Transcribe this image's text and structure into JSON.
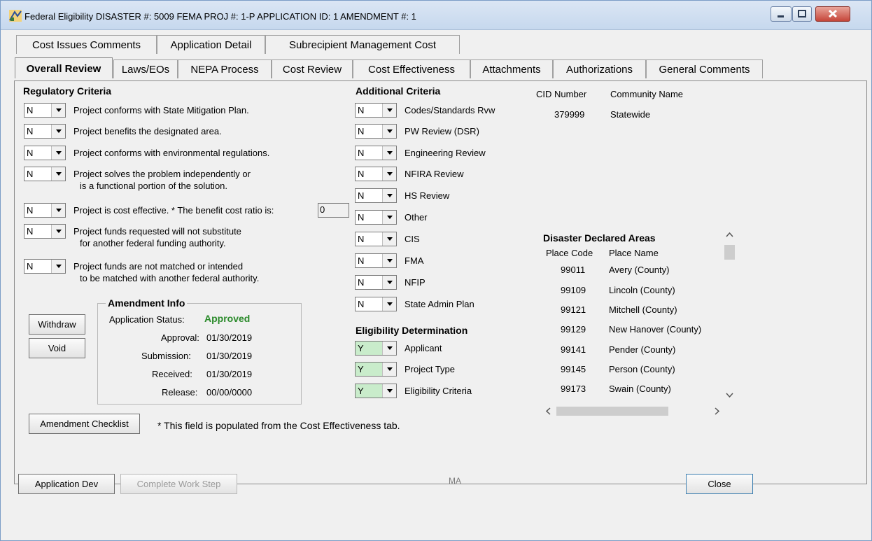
{
  "window": {
    "title": "Federal Eligibility  DISASTER #: 5009   FEMA PROJ #: 1-P   APPLICATION ID: 1   AMENDMENT #: 1"
  },
  "tabs_row1": [
    "Cost Issues Comments",
    "Application Detail",
    "Subrecipient Management Cost"
  ],
  "tabs_row2": [
    "Overall Review",
    "Laws/EOs",
    "NEPA Process",
    "Cost Review",
    "Cost Effectiveness",
    "Attachments",
    "Authorizations",
    "General Comments"
  ],
  "regulatory": {
    "heading": "Regulatory Criteria",
    "items": [
      {
        "value": "N",
        "line1": "Project conforms with State Mitigation Plan.",
        "line2": ""
      },
      {
        "value": "N",
        "line1": "Project benefits the designated area.",
        "line2": ""
      },
      {
        "value": "N",
        "line1": "Project conforms with environmental regulations.",
        "line2": ""
      },
      {
        "value": "N",
        "line1": "Project solves the problem independently or",
        "line2": "is a functional portion of the solution."
      },
      {
        "value": "N",
        "line1": "Project is cost effective.  * The benefit cost ratio is:",
        "line2": ""
      },
      {
        "value": "N",
        "line1": "Project funds requested will not substitute",
        "line2": "for another federal funding authority."
      },
      {
        "value": "N",
        "line1": "Project funds are not matched or intended",
        "line2": "to be matched with another federal authority."
      }
    ],
    "bcr_value": "0"
  },
  "additional": {
    "heading": "Additional Criteria",
    "items": [
      {
        "value": "N",
        "label": "Codes/Standards Rvw"
      },
      {
        "value": "N",
        "label": "PW Review (DSR)"
      },
      {
        "value": "N",
        "label": "Engineering Review"
      },
      {
        "value": "N",
        "label": "NFIRA Review"
      },
      {
        "value": "N",
        "label": "HS Review"
      },
      {
        "value": "N",
        "label": "Other"
      },
      {
        "value": "N",
        "label": "CIS"
      },
      {
        "value": "N",
        "label": "FMA"
      },
      {
        "value": "N",
        "label": "NFIP"
      },
      {
        "value": "N",
        "label": "State Admin Plan"
      }
    ]
  },
  "eligibility": {
    "heading": "Eligibility Determination",
    "items": [
      {
        "value": "Y",
        "label": "Applicant"
      },
      {
        "value": "Y",
        "label": "Project Type"
      },
      {
        "value": "Y",
        "label": "Eligibility Criteria"
      }
    ],
    "color": "#c9eccb"
  },
  "community": {
    "col_cid": "CID Number",
    "col_name": "Community Name",
    "cid": "379999",
    "name": "Statewide"
  },
  "declared": {
    "heading": "Disaster Declared Areas",
    "col_code": "Place Code",
    "col_name": "Place Name",
    "rows": [
      {
        "code": "99011",
        "name": "Avery (County)"
      },
      {
        "code": "99109",
        "name": "Lincoln (County)"
      },
      {
        "code": "99121",
        "name": "Mitchell (County)"
      },
      {
        "code": "99129",
        "name": "New Hanover (County)"
      },
      {
        "code": "99141",
        "name": "Pender (County)"
      },
      {
        "code": "99145",
        "name": "Person (County)"
      },
      {
        "code": "99173",
        "name": "Swain (County)"
      }
    ]
  },
  "amendment": {
    "heading": "Amendment Info",
    "status_label": "Application Status:",
    "status_value": "Approved",
    "status_color": "#2a8a2a",
    "approval_label": "Approval:",
    "approval_value": "01/30/2019",
    "submission_label": "Submission:",
    "submission_value": "01/30/2019",
    "received_label": "Received:",
    "received_value": "01/30/2019",
    "release_label": "Release:",
    "release_value": "00/00/0000"
  },
  "buttons": {
    "withdraw": "Withdraw",
    "void": "Void",
    "amendment_checklist": "Amendment Checklist",
    "application_dev": "Application Dev",
    "complete_work_step": "Complete Work Step",
    "close": "Close"
  },
  "footnote": "* This field is populated from the Cost Effectiveness tab.",
  "state_code": "MA"
}
